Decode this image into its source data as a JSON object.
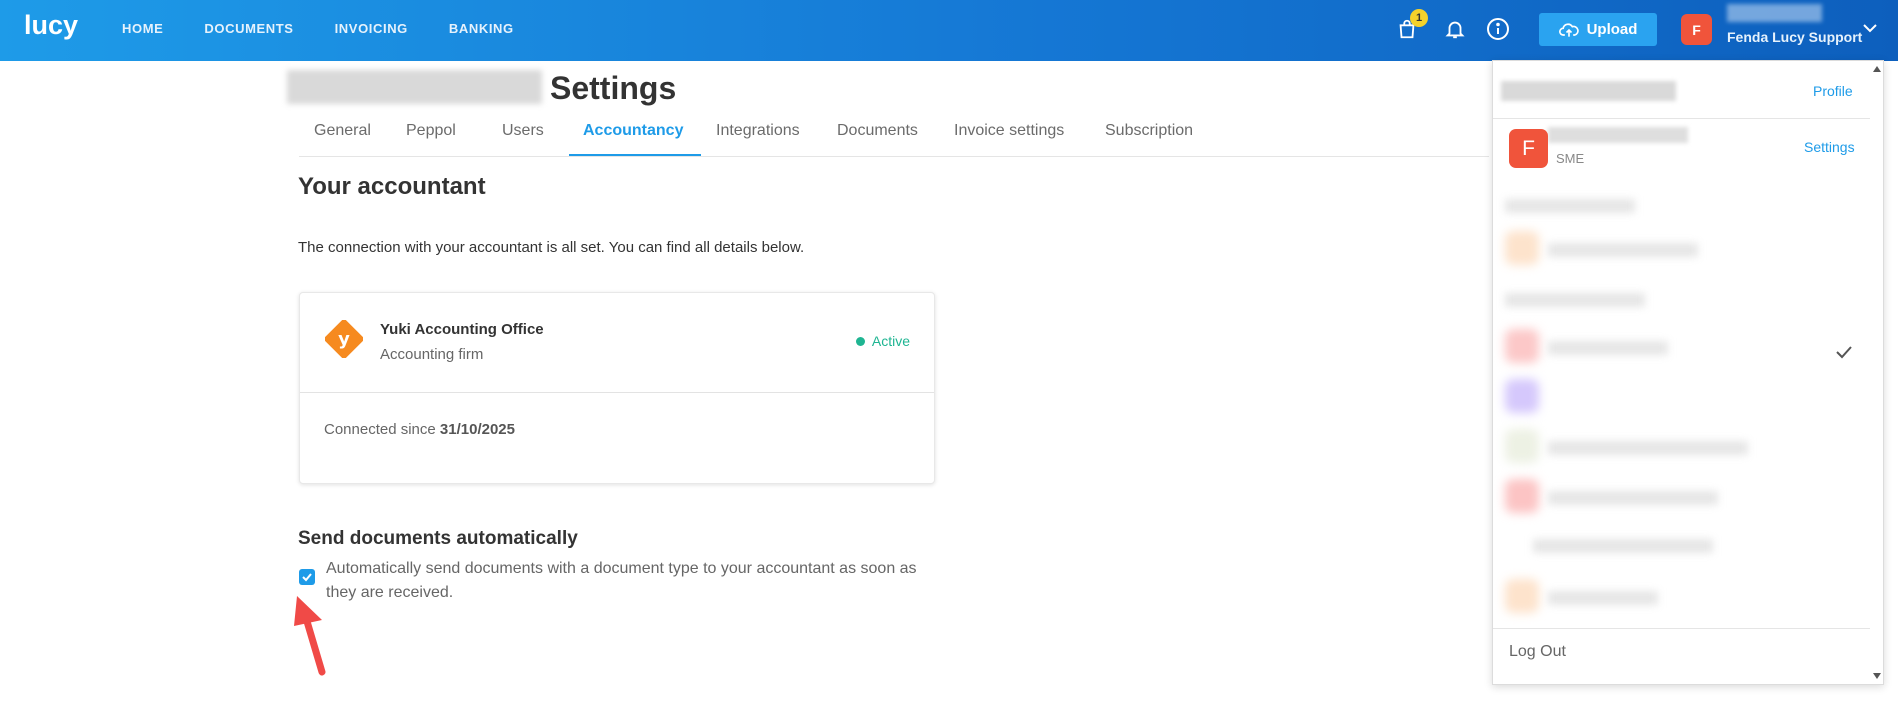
{
  "app": {
    "logo": "lucy"
  },
  "nav": {
    "items": [
      "HOME",
      "DOCUMENTS",
      "INVOICING",
      "BANKING"
    ]
  },
  "header": {
    "cart_count": "1",
    "upload_label": "Upload",
    "user_initial": "F",
    "user_org": "Fenda Lucy Support"
  },
  "page": {
    "title": "Settings",
    "tabs": [
      "General",
      "Peppol",
      "Users",
      "Accountancy",
      "Integrations",
      "Documents",
      "Invoice settings",
      "Subscription"
    ],
    "active_tab": "Accountancy"
  },
  "accountant": {
    "section_title": "Your accountant",
    "intro": "The connection with your accountant is all set. You can find all details below.",
    "logo_letter": "y",
    "name": "Yuki Accounting Office",
    "type": "Accounting firm",
    "status": "Active",
    "connected_label": "Connected since",
    "connected_date": "31/10/2025"
  },
  "auto_send": {
    "title": "Send documents automatically",
    "description": "Automatically send documents with a document type to your accountant as soon as they are received.",
    "checked": true
  },
  "dropdown": {
    "profile_link": "Profile",
    "company_initial": "F",
    "company_plan": "SME",
    "settings_link": "Settings",
    "logout": "Log Out"
  },
  "colors": {
    "brand_blue": "#1e9be8",
    "active_green": "#1fb592",
    "avatar_red": "#f0543b",
    "badge_yellow": "#f4d22b",
    "yuki_orange": "#f68a1f"
  }
}
